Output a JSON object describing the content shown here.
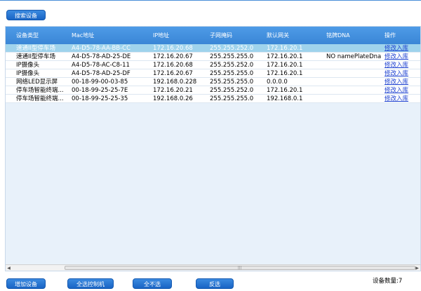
{
  "toolbar": {
    "search_label": "搜索设备"
  },
  "table": {
    "columns": [
      "设备类型",
      "Mac地址",
      "IP地址",
      "子网掩码",
      "默认网关",
      "铭牌DNA",
      "操作"
    ],
    "rows": [
      {
        "type": "速通II型停车场",
        "mac": "A4-D5-78-AA-BB-CC",
        "ip": "172.16.20.68",
        "mask": "255.255.252.0",
        "gateway": "172.16.20.1",
        "dna": "",
        "action": "修改入库",
        "selected": true
      },
      {
        "type": "速通II型停车场",
        "mac": "A4-D5-78-AD-25-DE",
        "ip": "172.16.20.67",
        "mask": "255.255.255.0",
        "gateway": "172.16.20.1",
        "dna": "NO namePlateDna",
        "action": "修改入库"
      },
      {
        "type": "IP摄像头",
        "mac": "A4-D5-78-AC-C8-11",
        "ip": "172.16.20.68",
        "mask": "255.255.252.0",
        "gateway": "172.16.20.1",
        "dna": "",
        "action": "修改入库"
      },
      {
        "type": "IP摄像头",
        "mac": "A4-D5-78-AD-25-DF",
        "ip": "172.16.20.67",
        "mask": "255.255.255.0",
        "gateway": "172.16.20.1",
        "dna": "",
        "action": "修改入库"
      },
      {
        "type": "网络LED显示屏",
        "mac": "00-18-99-00-03-85",
        "ip": "192.168.0.228",
        "mask": "255.255.255.0",
        "gateway": "0.0.0.0",
        "dna": "",
        "action": "修改入库"
      },
      {
        "type": "停车场智能终端...",
        "mac": "00-18-99-25-25-7E",
        "ip": "172.16.20.21",
        "mask": "255.255.252.0",
        "gateway": "172.16.20.1",
        "dna": "",
        "action": "修改入库"
      },
      {
        "type": "停车场智能终端...",
        "mac": "00-18-99-25-25-35",
        "ip": "192.168.0.26",
        "mask": "255.255.255.0",
        "gateway": "192.168.0.1",
        "dna": "",
        "action": "修改入库"
      }
    ]
  },
  "footer": {
    "add_label": "增加设备",
    "select_all_label": "全选控制机",
    "deselect_label": "全不选",
    "invert_label": "反选",
    "count_label": "设备数量:",
    "count_value": "7"
  },
  "colors": {
    "header": "#3a86d6",
    "selected_row": "#9fd3ec",
    "link": "#1a3fd0",
    "grid_bg": "#e8f1fa"
  },
  "icons": {
    "scroll_left": "triangle-left",
    "scroll_right": "triangle-right",
    "scroll_grip": "grip-lines"
  }
}
